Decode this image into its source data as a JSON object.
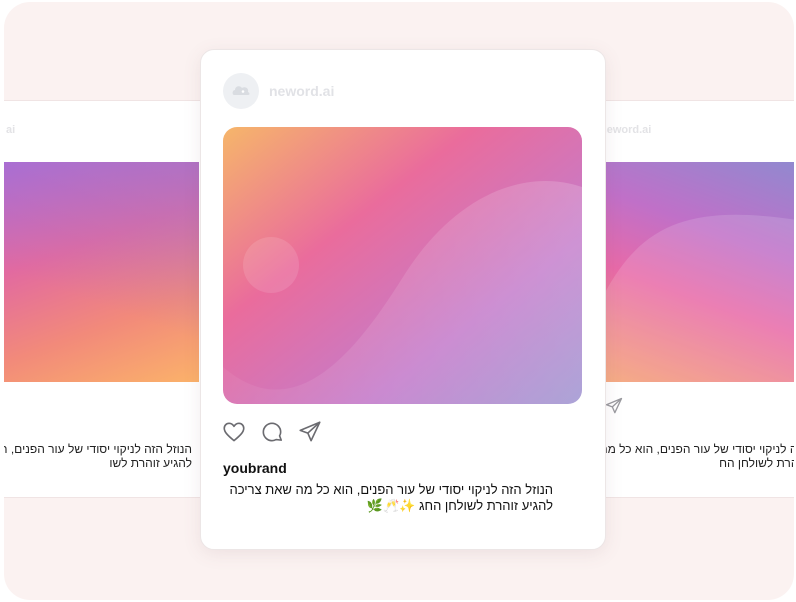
{
  "brand": {
    "name": "neword.ai",
    "side_name": "neword.ai",
    "side_name_left": "ai"
  },
  "post": {
    "username": "youbrand",
    "caption_line1": "הנוזל הזה לניקוי יסודי של עור הפנים, הוא כל מה שאת צריכה",
    "caption_line2": "להגיע זוהרת לשולחן החג ✨🥂🌿"
  },
  "side_left": {
    "caption_line1": "הנוזל הזה לניקוי יסודי של עור הפנים, הוא כ",
    "caption_line2": "להגיע זוהרת לשו"
  },
  "side_right": {
    "caption_line1": "הנוזל הזה לניקוי יסודי של עור הפנים, הוא כל מה",
    "caption_line2": "להגיע זוהרת לשולחן הח"
  },
  "icons": [
    "heart-icon",
    "comment-icon",
    "send-icon",
    "brand-logo-icon"
  ],
  "colors": {
    "stage": "#fbf2f1",
    "gradient": [
      "#f6b46a",
      "#e9679f",
      "#c47ccb",
      "#9a8fcf"
    ]
  }
}
